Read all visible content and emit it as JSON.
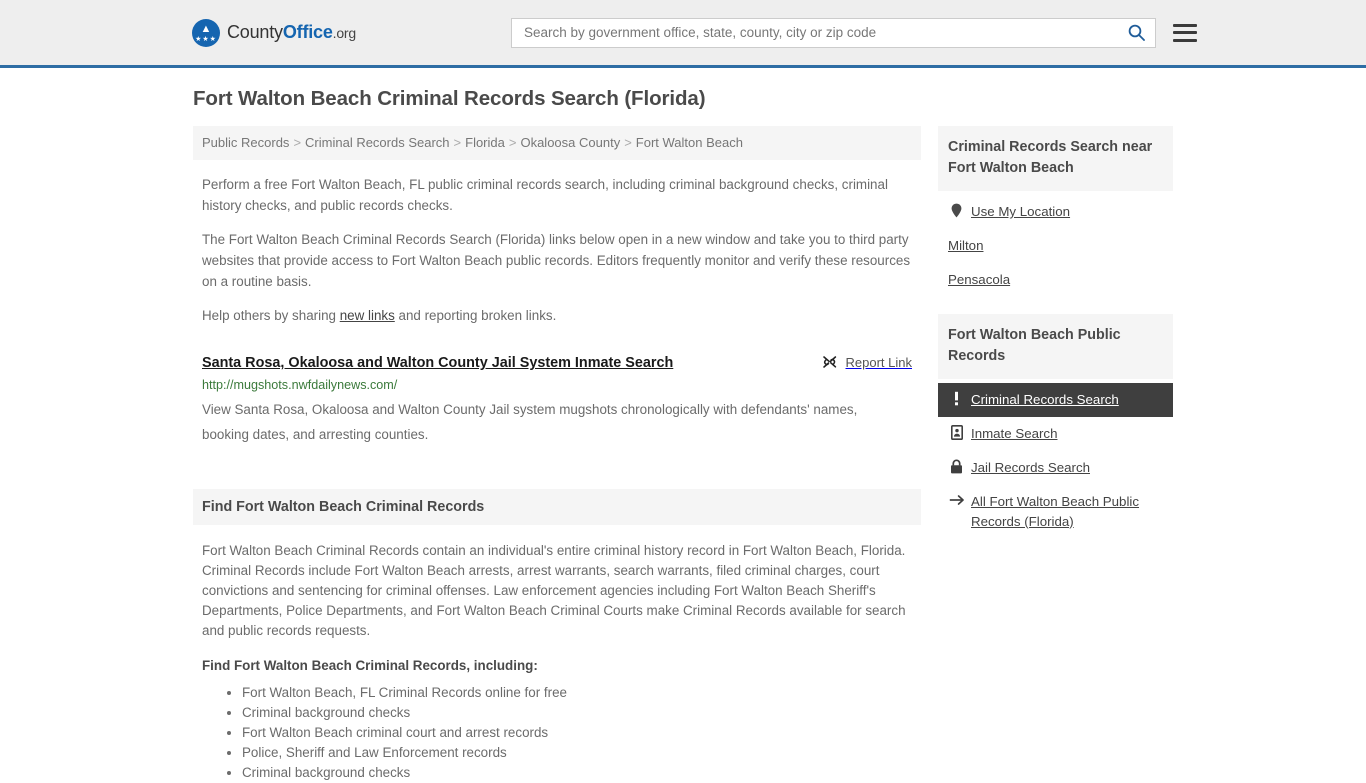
{
  "header": {
    "brand": {
      "part1": "County",
      "part2": "Office",
      "part3": ".org"
    },
    "search": {
      "placeholder": "Search by government office, state, county, city or zip code",
      "value": ""
    },
    "search_icon": "search-icon",
    "menu_icon": "hamburger-menu-icon"
  },
  "page": {
    "title": "Fort Walton Beach Criminal Records Search (Florida)"
  },
  "breadcrumb": {
    "items": [
      {
        "label": "Public Records"
      },
      {
        "label": "Criminal Records Search"
      },
      {
        "label": "Florida"
      },
      {
        "label": "Okaloosa County"
      },
      {
        "label": "Fort Walton Beach"
      }
    ],
    "separator": ">"
  },
  "intro": {
    "p1": "Perform a free Fort Walton Beach, FL public criminal records search, including criminal background checks, criminal history checks, and public records checks.",
    "p2": "The Fort Walton Beach Criminal Records Search (Florida) links below open in a new window and take you to third party websites that provide access to Fort Walton Beach public records. Editors frequently monitor and verify these resources on a routine basis.",
    "p3_before": "Help others by sharing ",
    "p3_link": "new links",
    "p3_after": " and reporting broken links."
  },
  "result": {
    "title": "Santa Rosa, Okaloosa and Walton County Jail System Inmate Search",
    "url": "http://mugshots.nwfdailynews.com/",
    "description": "View Santa Rosa, Okaloosa and Walton County Jail system mugshots chronologically with defendants' names, booking dates, and arresting counties.",
    "report_label": "Report Link",
    "report_icon": "broken-link-icon"
  },
  "find_section": {
    "header": "Find Fort Walton Beach Criminal Records",
    "paragraph": "Fort Walton Beach Criminal Records contain an individual's entire criminal history record in Fort Walton Beach, Florida. Criminal Records include Fort Walton Beach arrests, arrest warrants, search warrants, filed criminal charges, court convictions and sentencing for criminal offenses. Law enforcement agencies including Fort Walton Beach Sheriff's Departments, Police Departments, and Fort Walton Beach Criminal Courts make Criminal Records available for search and public records requests.",
    "sub_head": "Find Fort Walton Beach Criminal Records, including:",
    "bullets": [
      "Fort Walton Beach, FL Criminal Records online for free",
      "Criminal background checks",
      "Fort Walton Beach criminal court and arrest records",
      "Police, Sheriff and Law Enforcement records",
      "Criminal background checks"
    ]
  },
  "sidebar": {
    "nearby_card": {
      "header": "Criminal Records Search near Fort Walton Beach",
      "items": [
        {
          "label": "Use My Location",
          "icon": "map-pin-icon"
        },
        {
          "label": "Milton",
          "icon": ""
        },
        {
          "label": "Pensacola",
          "icon": ""
        }
      ]
    },
    "public_records_card": {
      "header": "Fort Walton Beach Public Records",
      "items": [
        {
          "label": "Criminal Records Search",
          "icon": "exclamation-icon",
          "active": true
        },
        {
          "label": "Inmate Search",
          "icon": "id-badge-icon",
          "active": false
        },
        {
          "label": "Jail Records Search",
          "icon": "padlock-icon",
          "active": false
        },
        {
          "label": "All Fort Walton Beach Public Records (Florida)",
          "icon": "arrow-right-icon",
          "active": false
        }
      ]
    }
  },
  "colors": {
    "header_bg": "#eeeeee",
    "header_border": "#2e6da4",
    "brand_blue": "#1565b0",
    "panel_bg": "#f5f5f5",
    "active_item_bg": "#3f3f3f",
    "url_green": "#3b7a3b",
    "body_text": "#6b6b6b"
  }
}
